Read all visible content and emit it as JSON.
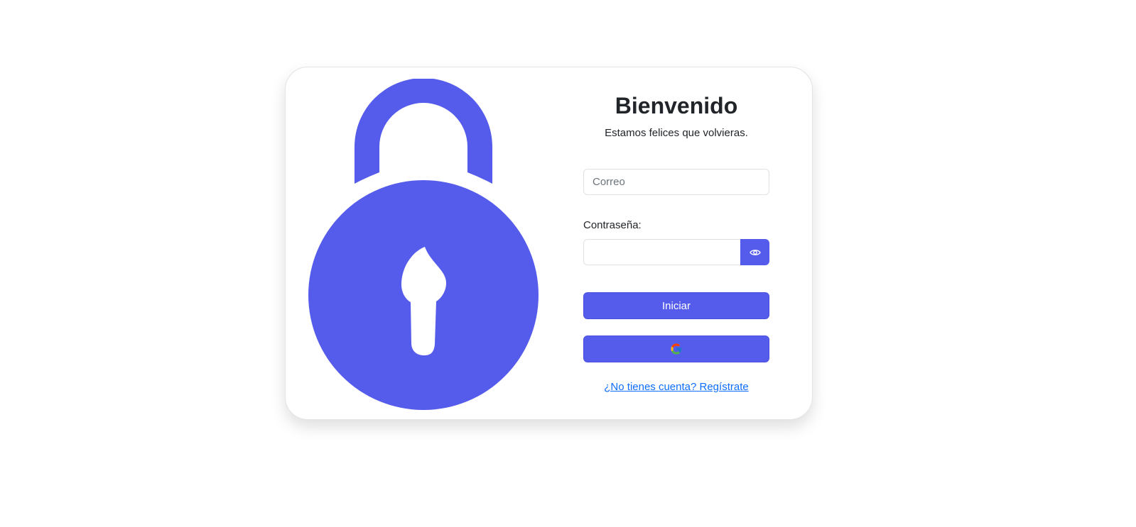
{
  "brand": {
    "accent_color": "#555ceb",
    "link_color": "#0d6efd"
  },
  "illustration": {
    "icon": "padlock-icon"
  },
  "login": {
    "title": "Bienvenido",
    "subtitle": "Estamos felices que volvieras.",
    "email_placeholder": "Correo",
    "email_value": "",
    "password_label": "Contraseña:",
    "password_value": "",
    "toggle_password_icon": "eye-icon",
    "submit_label": "Iniciar",
    "google_icon": "google-icon",
    "register_link": "¿No tienes cuenta? Regístrate"
  }
}
